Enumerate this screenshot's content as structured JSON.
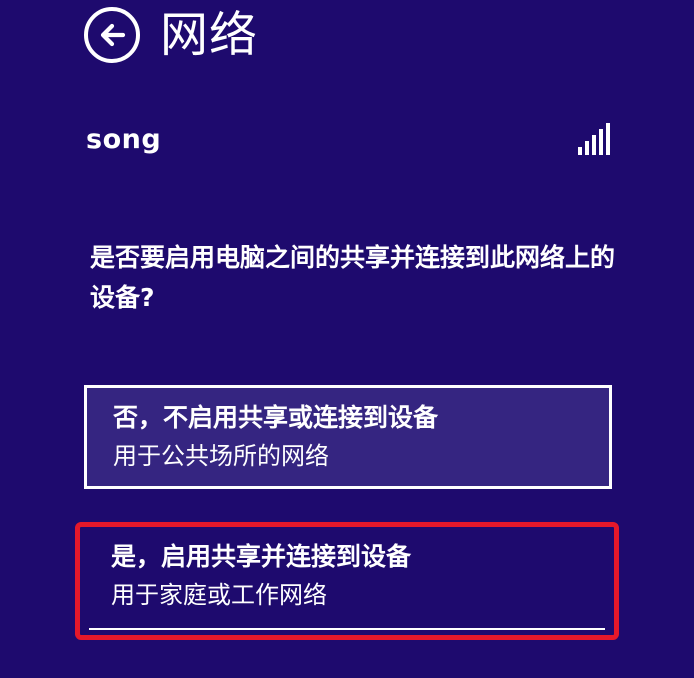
{
  "header": {
    "back_icon": "back-arrow-circle-icon",
    "title": "网络"
  },
  "network": {
    "name": "song",
    "signal_icon": "signal-strength-icon",
    "signal_bars": 5
  },
  "prompt": {
    "question": "是否要启用电脑之间的共享并连接到此网络上的设备?"
  },
  "options": [
    {
      "title": "否，不启用共享或连接到设备",
      "description": "用于公共场所的网络"
    },
    {
      "title": "是，启用共享并连接到设备",
      "description": "用于家庭或工作网络"
    }
  ],
  "colors": {
    "background": "#1e0a6e",
    "option_highlight": "#352581",
    "annotation_red": "#e5182a",
    "text": "#ffffff"
  }
}
